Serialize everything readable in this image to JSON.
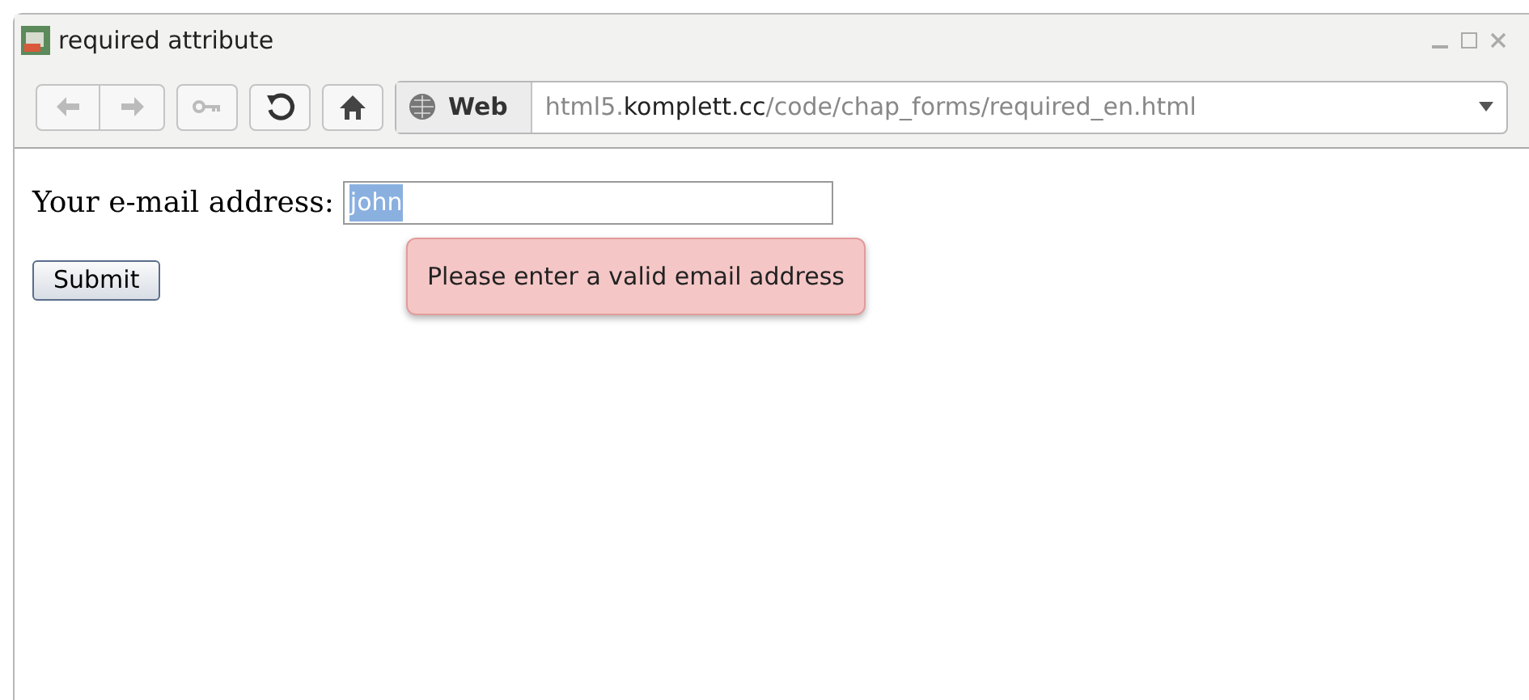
{
  "window": {
    "title": "required attribute"
  },
  "toolbar": {
    "location_label": "Web",
    "url": "html5.**komplett.cc**/code/chap_forms/required_en.html"
  },
  "form": {
    "label": "Your e-mail address:",
    "field": {
      "value": "john",
      "text_selected": true
    },
    "button": "Submit"
  },
  "tooltip": {
    "text": "Please enter a valid email address"
  }
}
